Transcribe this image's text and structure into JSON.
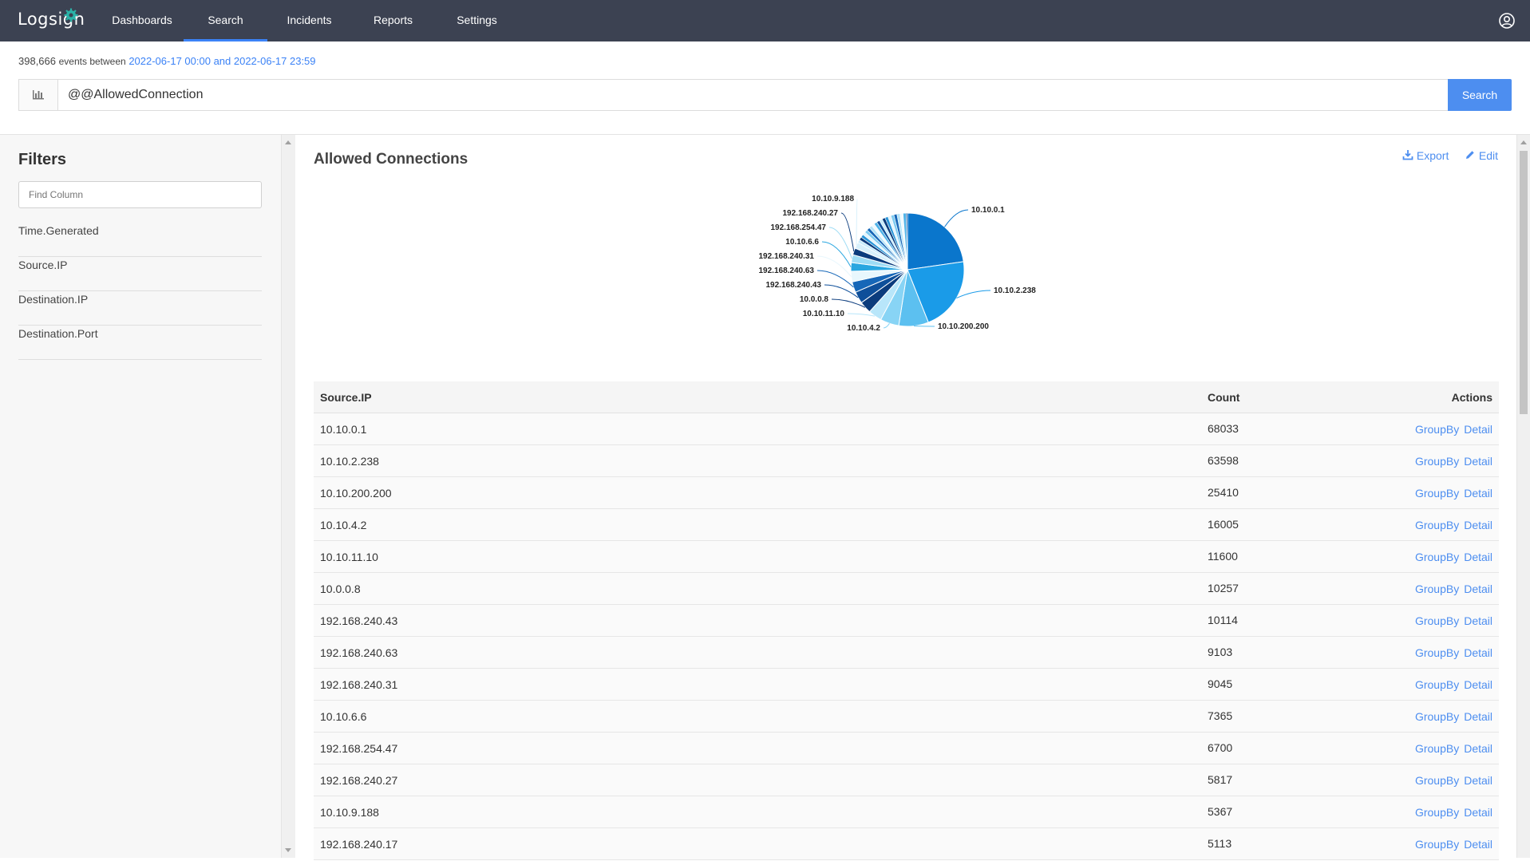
{
  "app": {
    "logo": "Logsign"
  },
  "nav": {
    "items": [
      {
        "label": "Dashboards",
        "active": false
      },
      {
        "label": "Search",
        "active": true
      },
      {
        "label": "Incidents",
        "active": false
      },
      {
        "label": "Reports",
        "active": false
      },
      {
        "label": "Settings",
        "active": false
      }
    ]
  },
  "summary": {
    "count": "398,666",
    "between_text": "events between",
    "range": "2022-06-17 00:00 and 2022-06-17 23:59"
  },
  "search": {
    "query": "@@AllowedConnection",
    "button_label": "Search"
  },
  "filters": {
    "title": "Filters",
    "find_placeholder": "Find Column",
    "items": [
      "Time.Generated",
      "Source.IP",
      "Destination.IP",
      "Destination.Port"
    ]
  },
  "panel": {
    "title": "Allowed Connections",
    "export_label": "Export",
    "edit_label": "Edit"
  },
  "table": {
    "headers": {
      "ip": "Source.IP",
      "count": "Count",
      "actions": "Actions"
    },
    "action_labels": {
      "groupby": "GroupBy",
      "detail": "Detail"
    },
    "rows": [
      {
        "ip": "10.10.0.1",
        "count": "68033"
      },
      {
        "ip": "10.10.2.238",
        "count": "63598"
      },
      {
        "ip": "10.10.200.200",
        "count": "25410"
      },
      {
        "ip": "10.10.4.2",
        "count": "16005"
      },
      {
        "ip": "10.10.11.10",
        "count": "11600"
      },
      {
        "ip": "10.0.0.8",
        "count": "10257"
      },
      {
        "ip": "192.168.240.43",
        "count": "10114"
      },
      {
        "ip": "192.168.240.63",
        "count": "9103"
      },
      {
        "ip": "192.168.240.31",
        "count": "9045"
      },
      {
        "ip": "10.10.6.6",
        "count": "7365"
      },
      {
        "ip": "192.168.254.47",
        "count": "6700"
      },
      {
        "ip": "192.168.240.27",
        "count": "5817"
      },
      {
        "ip": "10.10.9.188",
        "count": "5367"
      },
      {
        "ip": "192.168.240.17",
        "count": "5113"
      }
    ]
  },
  "chart_data": {
    "type": "pie",
    "categories": [
      "10.10.0.1",
      "10.10.2.238",
      "10.10.200.200",
      "10.10.4.2",
      "10.10.11.10",
      "10.0.0.8",
      "192.168.240.43",
      "192.168.240.63",
      "192.168.240.31",
      "10.10.6.6",
      "192.168.254.47",
      "192.168.240.27",
      "10.10.9.188"
    ],
    "values": [
      68033,
      63598,
      25410,
      16005,
      11600,
      10257,
      10114,
      9103,
      9045,
      7365,
      6700,
      5817,
      5367
    ],
    "colors": {
      "10.10.0.1": "#0a76cc",
      "10.10.2.238": "#1a9be8",
      "10.10.200.200": "#5cc0f0",
      "10.10.4.2": "#88d4f5",
      "10.10.11.10": "#b8e6fa",
      "10.0.0.8": "#0b3c7d",
      "192.168.240.43": "#0e4f9a",
      "192.168.240.63": "#1667b8",
      "192.168.240.31": "#e8f7fd",
      "10.10.6.6": "#29a6e0",
      "192.168.254.47": "#9edcf5",
      "192.168.240.27": "#0b3c7d",
      "10.10.9.188": "#d7f0fb"
    },
    "title": "",
    "legend": "none"
  }
}
